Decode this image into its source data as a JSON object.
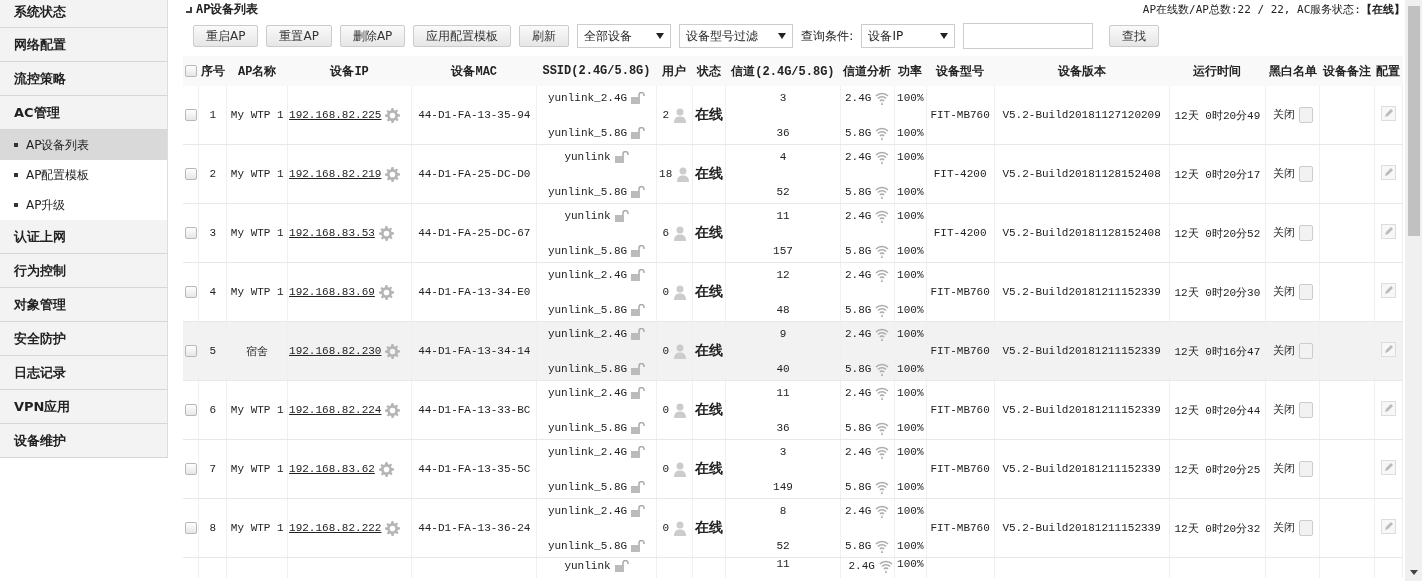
{
  "sidebar": {
    "items": [
      {
        "label": "系统状态",
        "selected": false
      },
      {
        "label": "网络配置",
        "selected": false
      },
      {
        "label": "流控策略",
        "selected": false
      },
      {
        "label": "AC管理",
        "selected": false,
        "children": [
          {
            "label": "AP设备列表",
            "selected": true
          },
          {
            "label": "AP配置模板",
            "selected": false
          },
          {
            "label": "AP升级",
            "selected": false
          }
        ]
      },
      {
        "label": "认证上网",
        "selected": false
      },
      {
        "label": "行为控制",
        "selected": false
      },
      {
        "label": "对象管理",
        "selected": false
      },
      {
        "label": "安全防护",
        "selected": false
      },
      {
        "label": "日志记录",
        "selected": false
      },
      {
        "label": "VPN应用",
        "selected": false
      },
      {
        "label": "设备维护",
        "selected": false
      }
    ]
  },
  "page": {
    "title": "AP设备列表",
    "summary": "AP在线数/AP总数:22 / 22, AC服务状态:**【在线】**"
  },
  "toolbar": {
    "items": [
      {
        "kind": "button",
        "label": "重启AP"
      },
      {
        "kind": "button",
        "label": "重置AP"
      },
      {
        "kind": "button",
        "label": "删除AP"
      },
      {
        "kind": "button",
        "label": "应用配置模板"
      },
      {
        "kind": "button",
        "label": "刷新"
      },
      {
        "kind": "select",
        "value": "全部设备"
      },
      {
        "kind": "select",
        "value": "设备型号过滤"
      },
      {
        "kind": "label",
        "label": "查询条件:"
      },
      {
        "kind": "select",
        "value": "设备IP"
      },
      {
        "kind": "input",
        "value": ""
      },
      {
        "kind": "button",
        "label": "查找"
      }
    ]
  },
  "table": {
    "all_checked": false,
    "columns": [
      "序号",
      "AP名称",
      "设备IP",
      "设备MAC",
      "SSID(2.4G/5.8G)",
      "用户",
      "状态",
      "信道(2.4G/5.8G)",
      "信道分析",
      "功率",
      "设备型号",
      "设备版本",
      "运行时间",
      "黑白名单",
      "设备备注",
      "配置"
    ],
    "rows": [
      {
        "checked": false,
        "highlighted": false,
        "index": "1",
        "name": "My WTP 1",
        "ip": "192.168.82.225",
        "mac": "44-D1-FA-13-35-94",
        "ssids": [
          "yunlink_2.4G",
          "yunlink_5.8G"
        ],
        "users": "2",
        "status": "在线",
        "channels": [
          "3",
          "36"
        ],
        "bands": [
          {
            "band": "2.4G",
            "power": "100%"
          },
          {
            "band": "5.8G",
            "power": "100%"
          }
        ],
        "model": "FIT-MB760",
        "version": "V5.2-Build20181127120209",
        "uptime": "12天 0时20分49",
        "list_mode": "关闭",
        "list_checked": false
      },
      {
        "checked": false,
        "highlighted": false,
        "index": "2",
        "name": "My WTP 1",
        "ip": "192.168.82.219",
        "mac": "44-D1-FA-25-DC-D0",
        "ssids": [
          "yunlink",
          "yunlink_5.8G"
        ],
        "users": "18",
        "status": "在线",
        "channels": [
          "4",
          "52"
        ],
        "bands": [
          {
            "band": "2.4G",
            "power": "100%"
          },
          {
            "band": "5.8G",
            "power": "100%"
          }
        ],
        "model": "FIT-4200",
        "version": "V5.2-Build20181128152408",
        "uptime": "12天 0时20分17",
        "list_mode": "关闭",
        "list_checked": false
      },
      {
        "checked": false,
        "highlighted": false,
        "index": "3",
        "name": "My WTP 1",
        "ip": "192.168.83.53",
        "mac": "44-D1-FA-25-DC-67",
        "ssids": [
          "yunlink",
          "yunlink_5.8G"
        ],
        "users": "6",
        "status": "在线",
        "channels": [
          "11",
          "157"
        ],
        "bands": [
          {
            "band": "2.4G",
            "power": "100%"
          },
          {
            "band": "5.8G",
            "power": "100%"
          }
        ],
        "model": "FIT-4200",
        "version": "V5.2-Build20181128152408",
        "uptime": "12天 0时20分52",
        "list_mode": "关闭",
        "list_checked": false
      },
      {
        "checked": false,
        "highlighted": false,
        "index": "4",
        "name": "My WTP 1",
        "ip": "192.168.83.69",
        "mac": "44-D1-FA-13-34-E0",
        "ssids": [
          "yunlink_2.4G",
          "yunlink_5.8G"
        ],
        "users": "0",
        "status": "在线",
        "channels": [
          "12",
          "48"
        ],
        "bands": [
          {
            "band": "2.4G",
            "power": "100%"
          },
          {
            "band": "5.8G",
            "power": "100%"
          }
        ],
        "model": "FIT-MB760",
        "version": "V5.2-Build20181211152339",
        "uptime": "12天 0时20分30",
        "list_mode": "关闭",
        "list_checked": false
      },
      {
        "checked": false,
        "highlighted": true,
        "index": "5",
        "name": "宿舍",
        "ip": "192.168.82.230",
        "mac": "44-D1-FA-13-34-14",
        "ssids": [
          "yunlink_2.4G",
          "yunlink_5.8G"
        ],
        "users": "0",
        "status": "在线",
        "channels": [
          "9",
          "40"
        ],
        "bands": [
          {
            "band": "2.4G",
            "power": "100%"
          },
          {
            "band": "5.8G",
            "power": "100%"
          }
        ],
        "model": "FIT-MB760",
        "version": "V5.2-Build20181211152339",
        "uptime": "12天 0时16分47",
        "list_mode": "关闭",
        "list_checked": false
      },
      {
        "checked": false,
        "highlighted": false,
        "index": "6",
        "name": "My WTP 1",
        "ip": "192.168.82.224",
        "mac": "44-D1-FA-13-33-BC",
        "ssids": [
          "yunlink_2.4G",
          "yunlink_5.8G"
        ],
        "users": "0",
        "status": "在线",
        "channels": [
          "11",
          "36"
        ],
        "bands": [
          {
            "band": "2.4G",
            "power": "100%"
          },
          {
            "band": "5.8G",
            "power": "100%"
          }
        ],
        "model": "FIT-MB760",
        "version": "V5.2-Build20181211152339",
        "uptime": "12天 0时20分44",
        "list_mode": "关闭",
        "list_checked": false
      },
      {
        "checked": false,
        "highlighted": false,
        "index": "7",
        "name": "My WTP 1",
        "ip": "192.168.83.62",
        "mac": "44-D1-FA-13-35-5C",
        "ssids": [
          "yunlink_2.4G",
          "yunlink_5.8G"
        ],
        "users": "0",
        "status": "在线",
        "channels": [
          "3",
          "149"
        ],
        "bands": [
          {
            "band": "2.4G",
            "power": "100%"
          },
          {
            "band": "5.8G",
            "power": "100%"
          }
        ],
        "model": "FIT-MB760",
        "version": "V5.2-Build20181211152339",
        "uptime": "12天 0时20分25",
        "list_mode": "关闭",
        "list_checked": false
      },
      {
        "checked": false,
        "highlighted": false,
        "index": "8",
        "name": "My WTP 1",
        "ip": "192.168.82.222",
        "mac": "44-D1-FA-13-36-24",
        "ssids": [
          "yunlink_2.4G",
          "yunlink_5.8G"
        ],
        "users": "0",
        "status": "在线",
        "channels": [
          "8",
          "52"
        ],
        "bands": [
          {
            "band": "2.4G",
            "power": "100%"
          },
          {
            "band": "5.8G",
            "power": "100%"
          }
        ],
        "model": "FIT-MB760",
        "version": "V5.2-Build20181211152339",
        "uptime": "12天 0时20分32",
        "list_mode": "关闭",
        "list_checked": false
      }
    ],
    "partial_row": {
      "ssid": "yunlink",
      "channel": "11",
      "band": "2.4G",
      "power": "100%"
    }
  }
}
